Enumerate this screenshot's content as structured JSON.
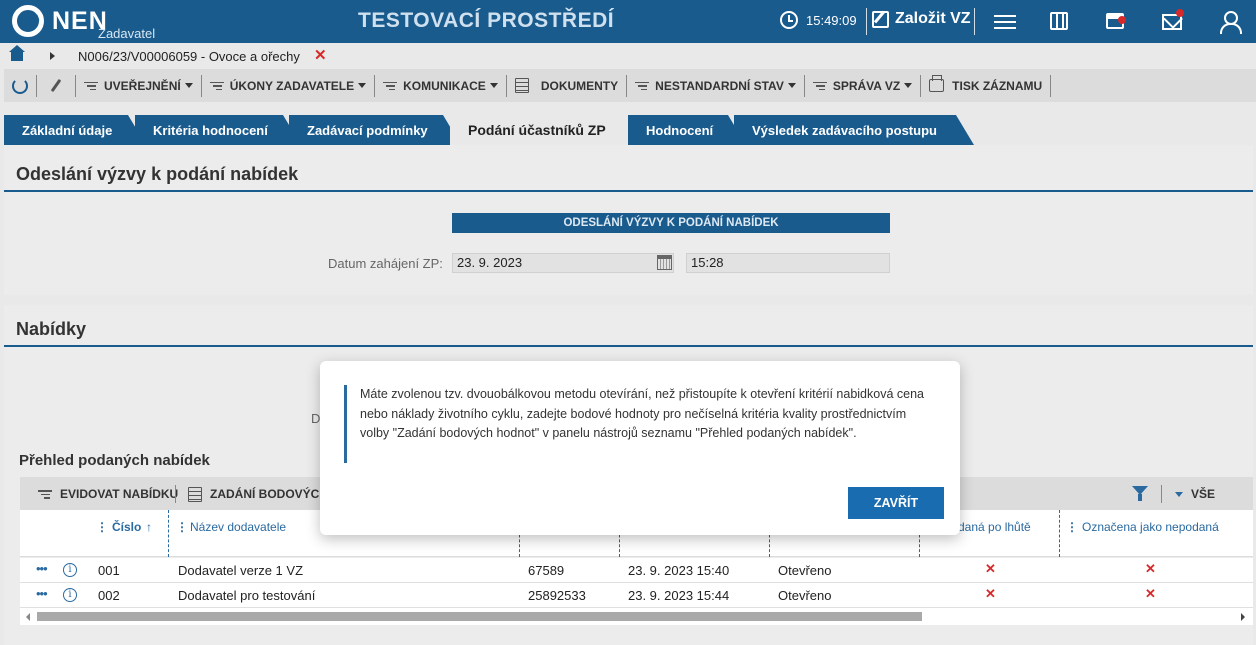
{
  "header": {
    "logo_text": "NEN",
    "logo_sub": "Zadavatel",
    "env_title": "TESTOVACÍ PROSTŘEDÍ",
    "time": "15:49:09",
    "create_label": "Založit VZ"
  },
  "breadcrumb": {
    "item": "N006/23/V00006059 - Ovoce a ořechy",
    "close": "✕"
  },
  "toolbar": {
    "items": [
      "UVEŘEJNĚNÍ",
      "ÚKONY ZADAVATELE",
      "KOMUNIKACE",
      "DOKUMENTY",
      "NESTANDARDNÍ STAV",
      "SPRÁVA VZ",
      "TISK ZÁZNAMU"
    ]
  },
  "tabs": [
    "Základní údaje",
    "Kritéria hodnocení",
    "Zadávací podmínky",
    "Podání účastníků ZP",
    "Hodnocení",
    "Výsledek zadávacího postupu"
  ],
  "section1": {
    "title": "Odeslání výzvy k podání nabídek",
    "bar_label": "ODESLÁNÍ VÝZVY K PODÁNÍ NABÍDEK",
    "date_label": "Datum zahájení ZP:",
    "date_value": "23. 9. 2023",
    "time_value": "15:28"
  },
  "section2": {
    "title": "Nabídky",
    "partial_label": "D",
    "subtitle": "Přehled podaných nabídek"
  },
  "grid": {
    "toolbar": {
      "evidovat": "EVIDOVAT NABÍDKU",
      "zadani": "ZADÁNÍ BODOVÝCH",
      "all": "VŠE"
    },
    "headers": {
      "cislo": "Číslo",
      "sort": "↑",
      "nazev": "Název dodavatele",
      "podana_po_lhute": "daná po lhůtě",
      "nepodana": "Označena jako nepodaná"
    },
    "rows": [
      {
        "cislo": "001",
        "nazev": "Dodavatel verze 1 VZ",
        "ico": "67589",
        "datum": "23. 9. 2023 15:40",
        "stav": "Otevřeno",
        "po_lhute": "✕",
        "nepodana": "✕"
      },
      {
        "cislo": "002",
        "nazev": "Dodavatel pro testování",
        "ico": "25892533",
        "datum": "23. 9. 2023 15:44",
        "stav": "Otevřeno",
        "po_lhute": "✕",
        "nepodana": "✕"
      }
    ]
  },
  "modal": {
    "text": "Máte zvolenou tzv. dvouobálkovou metodu otevírání, než přistoupíte k otevření kritérií nabidková cena nebo náklady životního cyklu, zadejte bodové hodnoty pro nečíselná kritéria kvality prostřednictvím volby \"Zadání bodových hodnot\" v panelu nástrojů seznamu \"Přehled podaných nabídek\".",
    "button": "ZAVŘÍT"
  },
  "colors": {
    "primary": "#1a5b8e",
    "button": "#1a6cb0",
    "danger": "#d62a2a"
  }
}
